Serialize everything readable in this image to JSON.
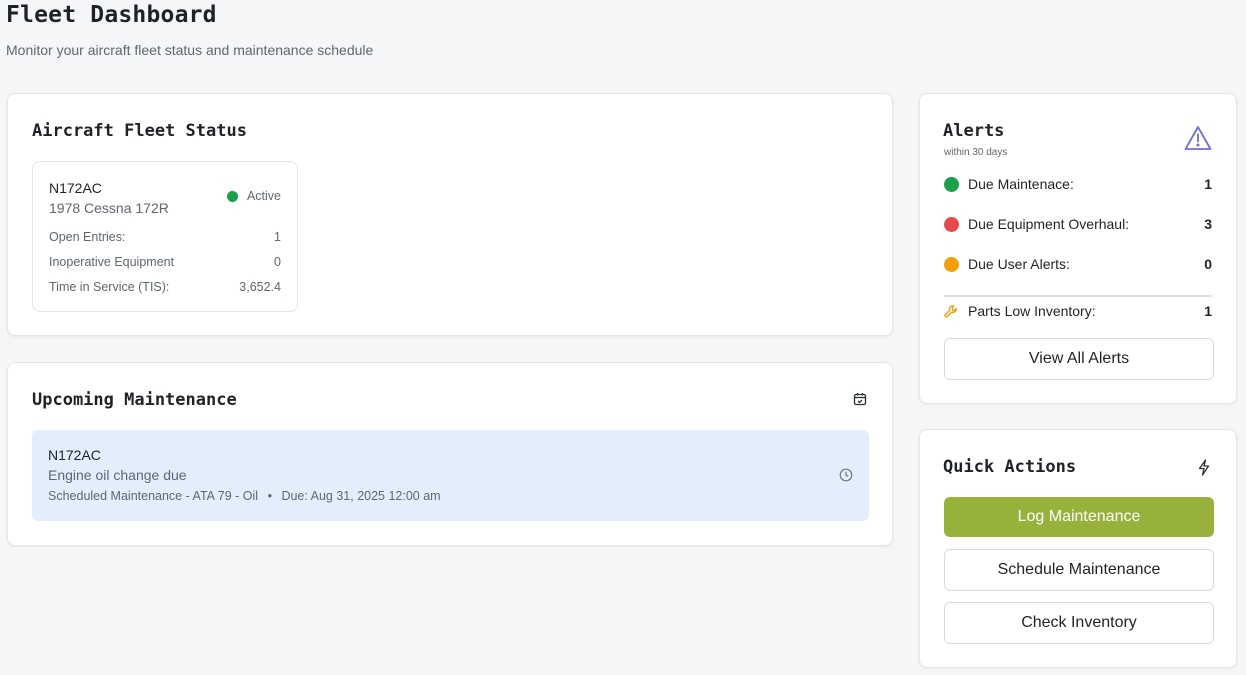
{
  "page": {
    "title": "Fleet Dashboard",
    "subtitle": "Monitor your aircraft fleet status and maintenance schedule"
  },
  "fleet": {
    "title": "Aircraft Fleet Status",
    "aircraft": {
      "registration": "N172AC",
      "model": "1978 Cessna 172R",
      "status": "Active",
      "status_color": "#1a9f4b",
      "rows": [
        {
          "label": "Open Entries:",
          "value": "1"
        },
        {
          "label": "Inoperative Equipment",
          "value": "0"
        },
        {
          "label": "Time in Service (TIS):",
          "value": "3,652.4"
        }
      ]
    }
  },
  "maintenance": {
    "title": "Upcoming Maintenance",
    "icon": "calendar-icon",
    "item": {
      "registration": "N172AC",
      "description": "Engine oil change due",
      "type": "Scheduled Maintenance - ATA 79 - Oil",
      "separator": "•",
      "due": "Due: Aug 31, 2025 12:00 am",
      "icon": "clock-icon"
    }
  },
  "alerts": {
    "title": "Alerts",
    "subtitle": "within 30 days",
    "icon": "warning-triangle-icon",
    "items": [
      {
        "label": "Due Maintenace:",
        "value": "1",
        "color": "#1a9f4b"
      },
      {
        "label": "Due Equipment Overhaul:",
        "value": "3",
        "color": "#e5484d"
      },
      {
        "label": "Due User Alerts:",
        "value": "0",
        "color": "#f59e0b"
      }
    ],
    "parts": {
      "label": "Parts Low Inventory:",
      "value": "1",
      "icon": "wrench-icon"
    },
    "view_all_label": "View All Alerts"
  },
  "quick_actions": {
    "title": "Quick Actions",
    "icon": "lightning-icon",
    "log_label": "Log Maintenance",
    "schedule_label": "Schedule Maintenance",
    "inventory_label": "Check Inventory",
    "accent": "#97b23a"
  }
}
